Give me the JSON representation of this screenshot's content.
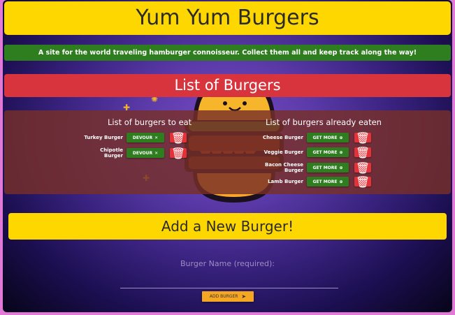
{
  "header": {
    "title": "Yum Yum Burgers"
  },
  "tagline": "A site for the world traveling hamburger connoisseur. Collect them all and keep track along the way!",
  "list_section": {
    "title": "List of Burgers"
  },
  "to_eat": {
    "heading": "List of burgers to eat",
    "button_label": "DEVOUR",
    "items": [
      {
        "name": "Turkey Burger"
      },
      {
        "name": "Chipotle Burger"
      }
    ]
  },
  "eaten": {
    "heading": "List of burgers already eaten",
    "button_label": "GET MORE",
    "items": [
      {
        "name": "Cheese Burger"
      },
      {
        "name": "Veggie Burger"
      },
      {
        "name": "Bacon Cheese Burger"
      },
      {
        "name": "Lamb Burger"
      }
    ]
  },
  "add_form": {
    "title": "Add a New Burger!",
    "field_label": "Burger Name (required):",
    "button_label": "ADD BURGER"
  },
  "colors": {
    "yellow": "#ffd700",
    "green": "#2e7d1f",
    "red": "#e53238",
    "orange": "#f5a623"
  }
}
